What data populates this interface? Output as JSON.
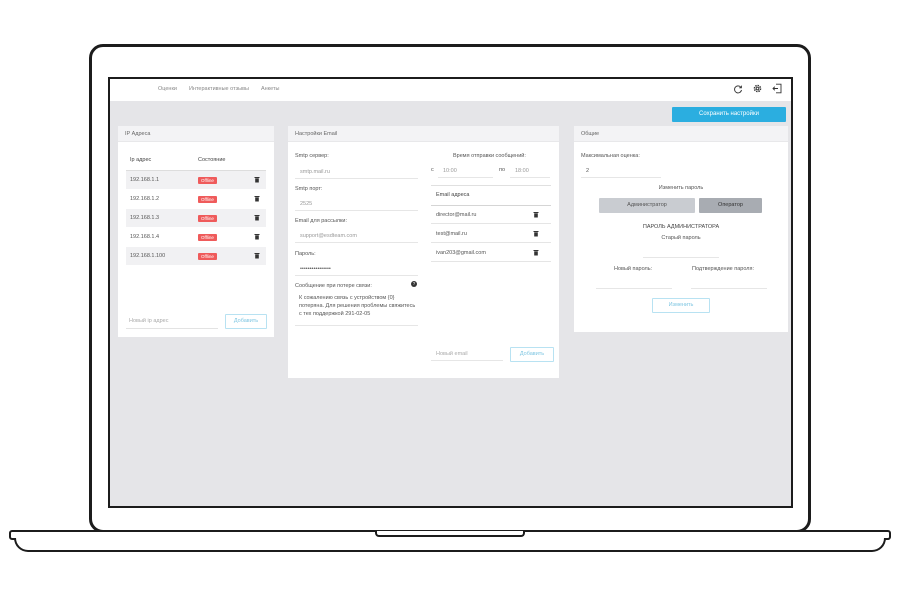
{
  "nav": {
    "items": [
      "Оценки",
      "Интерактивные отзывы",
      "Анкеты"
    ]
  },
  "icons": [
    "refresh-icon",
    "gear-icon",
    "logout-icon"
  ],
  "toolbar": {
    "save_label": "Сохранить настройки",
    "accent": "#2baee0"
  },
  "ip_card": {
    "title": "IP Адреса",
    "col_ip": "Ip адрес",
    "col_state": "Состояние",
    "rows": [
      {
        "ip": "192.168.1.1",
        "status": "Offline"
      },
      {
        "ip": "192.168.1.2",
        "status": "Offline"
      },
      {
        "ip": "192.168.1.3",
        "status": "Offline"
      },
      {
        "ip": "192.168.1.4",
        "status": "Offline"
      },
      {
        "ip": "192.168.1.100",
        "status": "Offline"
      }
    ],
    "status_color": "#ef5b5b",
    "new_placeholder": "Новый ip адрес",
    "add_label": "Добавить"
  },
  "email_card": {
    "title": "Настройки Email",
    "smtp_server_label": "Smtp сервер:",
    "smtp_server_value": "smtp.mail.ru",
    "smtp_port_label": "Smtp порт:",
    "smtp_port_value": "2525",
    "mailing_label": "Email для рассылки:",
    "mailing_value": "support@esdteam.com",
    "password_label": "Пароль:",
    "password_value": "••••••••••••••••",
    "lost_msg_label": "Сообщение при потере связи:",
    "help_glyph": "?",
    "lost_msg_value": "К сожалению связь с устройством {0} потеряна. Для решения проблемы свяжитесь с тех поддержкой 291-02-05",
    "send_time_label": "Время отправки сообщений:",
    "from_label": "с",
    "from_value": "10:00",
    "to_label": "по",
    "to_value": "18:00",
    "addresses_title": "Email адреса",
    "addresses": [
      "director@mail.ru",
      "test@mail.ru",
      "ivan203@gmail.com"
    ],
    "new_placeholder": "Новый email",
    "add_label": "Добавить"
  },
  "general_card": {
    "title": "Общие",
    "max_rating_label": "Максимальная оценка:",
    "max_rating_value": "2",
    "change_password_label": "Изменить пароль",
    "admin_tab": "Администратор",
    "operator_tab": "Оператор",
    "admin_password_title": "ПАРОЛЬ АДМИНИСТРАТОРА",
    "old_password_label": "Старый пароль",
    "new_password_label": "Новый пароль:",
    "confirm_password_label": "Подтверждение пароля:",
    "change_label": "Изменить"
  }
}
